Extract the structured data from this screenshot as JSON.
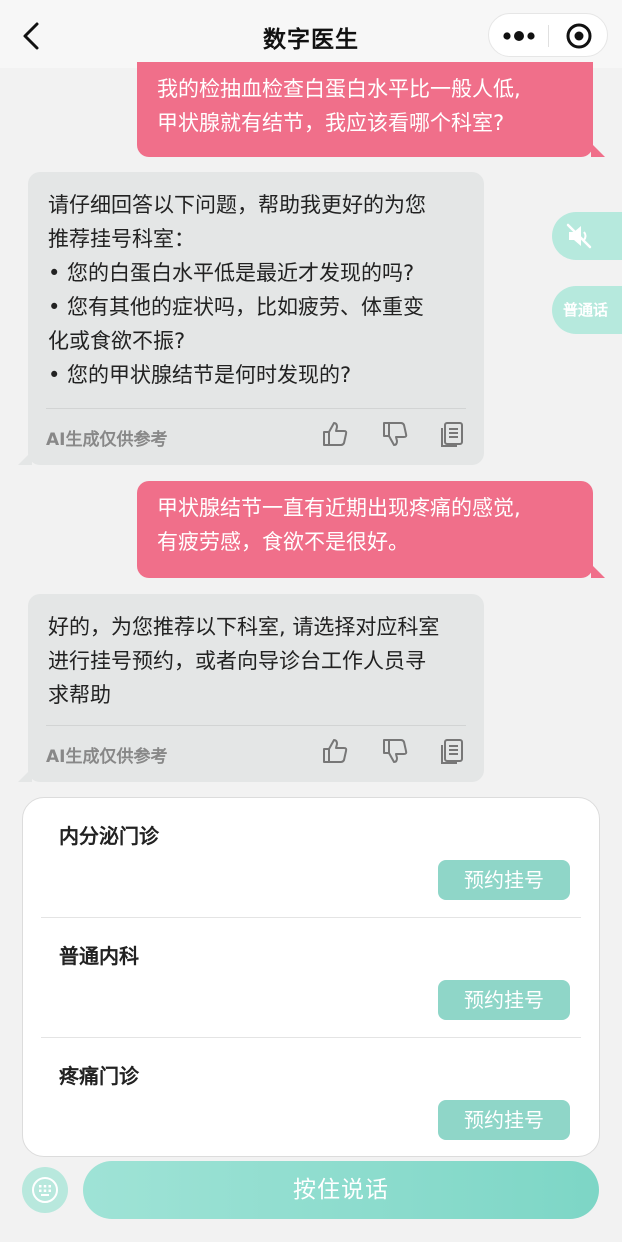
{
  "header": {
    "title": "数字医生"
  },
  "messages": {
    "user1": [
      "我的检抽血检查白蛋白水平比一般人低,",
      "甲状腺就有结节，我应该看哪个科室?"
    ],
    "ai1": [
      "请仔细回答以下问题，帮助我更好的为您",
      "推荐挂号科室：",
      "• 您的白蛋白水平低是最近才发现的吗?",
      "• 您有其他的症状吗，比如疲劳、体重变",
      "化或食欲不振?",
      "• 您的甲状腺结节是何时发现的?"
    ],
    "user2": [
      "甲状腺结节一直有近期出现疼痛的感觉,",
      "有疲劳感，食欲不是很好。"
    ],
    "ai2": [
      "好的，为您推荐以下科室, 请选择对应科室",
      "进行挂号预约，或者向导诊台工作人员寻",
      "求帮助"
    ],
    "ai_note": "AI生成仅供参考"
  },
  "side": {
    "lang_label": "普通话"
  },
  "departments": [
    {
      "name": "内分泌门诊",
      "button": "预约挂号"
    },
    {
      "name": "普通内科",
      "button": "预约挂号"
    },
    {
      "name": "疼痛门诊",
      "button": "预约挂号"
    }
  ],
  "bottom": {
    "talk_label": "按住说话"
  },
  "icons": {
    "back": "chevron-left-icon",
    "more": "more-dots-icon",
    "close": "target-close-icon",
    "mute": "speaker-muted-icon",
    "like": "thumb-up-icon",
    "dislike": "thumb-down-icon",
    "copy": "copy-icon",
    "keyboard": "keyboard-icon"
  },
  "colors": {
    "user_bubble": "#f06f8a",
    "ai_bubble": "#e4e6e6",
    "accent": "#8fd6c8"
  }
}
